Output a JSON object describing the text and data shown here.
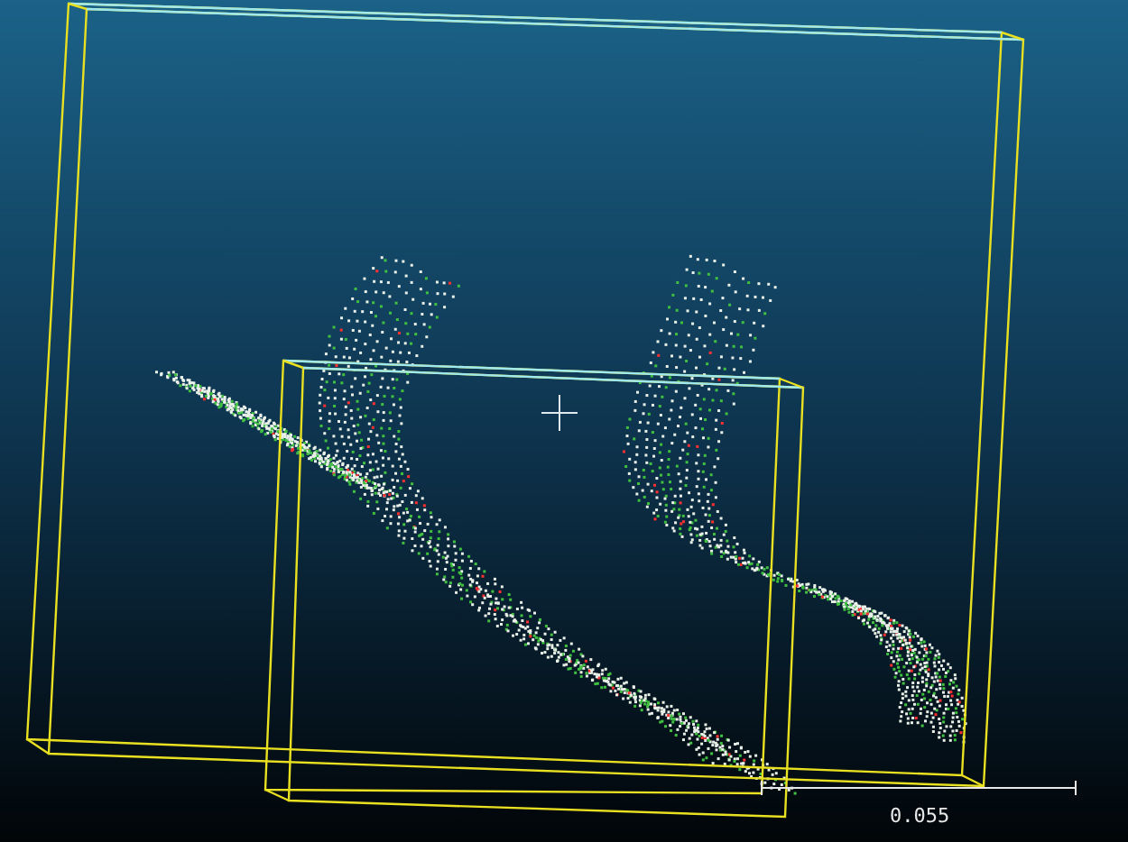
{
  "scale_bar": {
    "label": "0.055"
  }
}
